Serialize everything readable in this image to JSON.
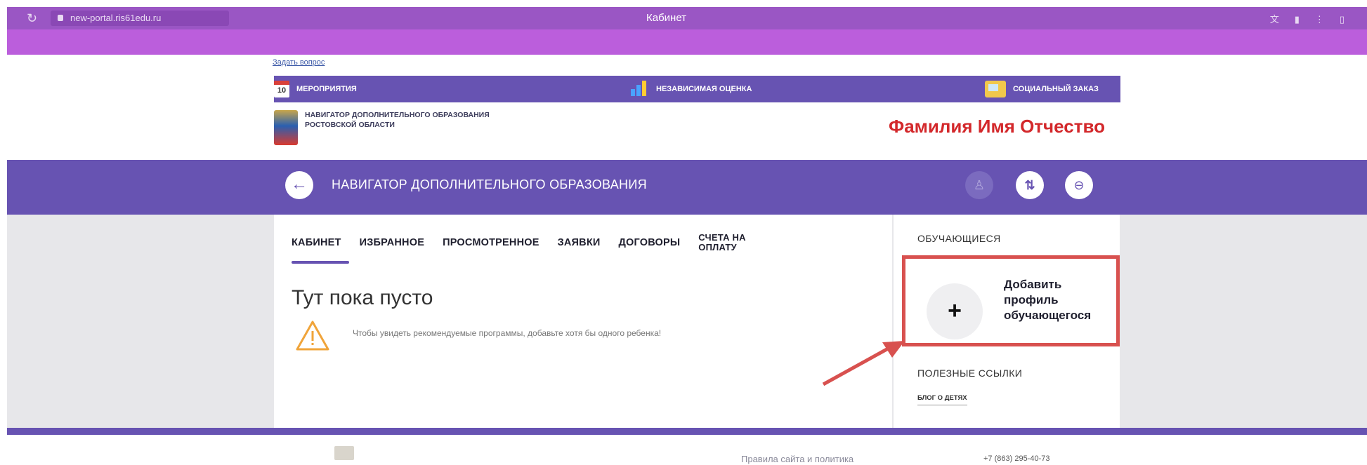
{
  "browser": {
    "url": "new-portal.ris61edu.ru",
    "tab_title": "Кабинет",
    "icons": [
      "translate-icon",
      "bookmark-icon",
      "menu-icon",
      "extension-icon"
    ]
  },
  "ask_question": "Задать вопрос",
  "top_nav": {
    "items": [
      {
        "label": "МЕРОПРИЯТИЯ",
        "icon": "calendar-icon",
        "badge": "10"
      },
      {
        "label": "НЕЗАВИСИМАЯ ОЦЕНКА",
        "icon": "chart-icon"
      },
      {
        "label": "СОЦИАЛЬНЫЙ ЗАКАЗ",
        "icon": "order-icon"
      }
    ]
  },
  "header": {
    "logo_text": "НАВИГАТОР ДОПОЛНИТЕЛЬНОГО ОБРАЗОВАНИЯ РОСТОВСКОЙ ОБЛАСТИ",
    "user_name": "Фамилия Имя Отчество"
  },
  "section_bar": {
    "back_icon": "←",
    "title": "НАВИГАТОР ДОПОЛНИТЕЛЬНОГО ОБРАЗОВАНИЯ",
    "user_icon": "♙",
    "filter_icon": "⇅",
    "exit_icon": "⊖"
  },
  "tabs": [
    {
      "label": "КАБИНЕТ",
      "active": true
    },
    {
      "label": "ИЗБРАННОЕ"
    },
    {
      "label": "ПРОСМОТРЕННОЕ"
    },
    {
      "label": "ЗАЯВКИ"
    },
    {
      "label": "ДОГОВОРЫ"
    },
    {
      "label": "СЧЕТА НА ОПЛАТУ"
    }
  ],
  "main": {
    "empty_title": "Тут пока пусто",
    "hint": "Чтобы увидеть рекомендуемые программы, добавьте хотя бы одного ребенка!"
  },
  "sidebar": {
    "students_heading": "ОБУЧАЮЩИЕСЯ",
    "add_profile_label": "Добавить профиль обучающегося",
    "add_profile_icon": "+",
    "useful_links_heading": "ПОЛЕЗНЫЕ ССЫЛКИ",
    "blog_link": "Блог о детях"
  },
  "footer": {
    "rules_text": "Правила сайта и политика",
    "phone": "+7 (863) 295-40-73"
  },
  "colors": {
    "browser_bar": "#9a56c4",
    "accent": "#6753b2",
    "highlight_red": "#d3282b",
    "annotation_red": "#d8514f"
  }
}
